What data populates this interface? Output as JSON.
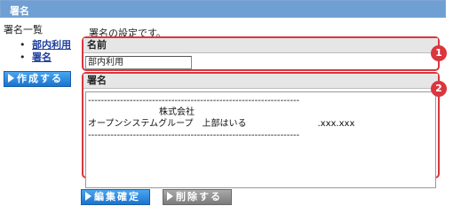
{
  "header": {
    "title": "署名"
  },
  "sidebar": {
    "title": "署名一覧",
    "items": [
      {
        "label": "部内利用"
      },
      {
        "label": "署名"
      }
    ],
    "create_button": "作成する"
  },
  "main": {
    "description": "署名の設定です。",
    "name_section": {
      "label": "名前",
      "value": "部内利用",
      "badge": "1"
    },
    "signature_section": {
      "label": "署名",
      "badge": "2",
      "lines": [
        "------------------------------------------------------------------",
        "　　　　　　　　株式会社",
        "オープンシステムグループ　上部はいる　　　　　　　　.xxx.xxx",
        "------------------------------------------------------------------"
      ]
    },
    "buttons": {
      "confirm": "編集確定",
      "delete": "削除する"
    }
  },
  "colors": {
    "titlebar": "#6f9fd3",
    "accent_red": "#d9363e",
    "button_blue": "#1a73cf",
    "button_gray": "#7b7b7b"
  }
}
